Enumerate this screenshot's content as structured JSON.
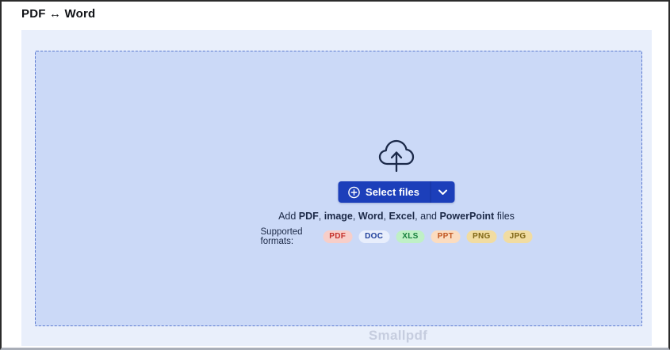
{
  "page": {
    "title": "PDF ↔ Word"
  },
  "uploader": {
    "cloud_icon": "cloud-upload-icon",
    "select_button": {
      "label": "Select files"
    },
    "add_line": {
      "segments": [
        "Add ",
        "PDF",
        ", ",
        "image",
        ", ",
        "Word",
        ", ",
        "Excel",
        ", and ",
        "PowerPoint",
        " files"
      ]
    },
    "supported_label": "Supported formats:",
    "badges": [
      {
        "label": "PDF",
        "bg": "#f7cec9",
        "fg": "#c4302b"
      },
      {
        "label": "DOC",
        "bg": "#e8eefc",
        "fg": "#1d3d99"
      },
      {
        "label": "XLS",
        "bg": "#bff0c6",
        "fg": "#157f3c"
      },
      {
        "label": "PPT",
        "bg": "#fbdcc0",
        "fg": "#c05621"
      },
      {
        "label": "PNG",
        "bg": "#f1dca2",
        "fg": "#7e6514"
      },
      {
        "label": "JPG",
        "bg": "#f1dca2",
        "fg": "#7e6514"
      }
    ]
  },
  "watermark": "Smallpdf",
  "colors": {
    "card_bg": "#e9effb",
    "dropzone_bg": "#cbd9f7",
    "dashed_border": "#5b79cf",
    "button_blue": "#1c3fba",
    "icon_stroke": "#1b2949"
  }
}
